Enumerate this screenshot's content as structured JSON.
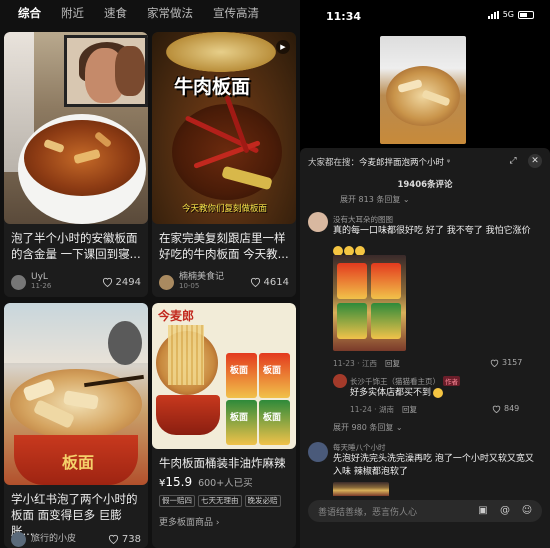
{
  "tabs": [
    "综合",
    "附近",
    "速食",
    "家常做法",
    "宣传高清"
  ],
  "feed": {
    "cards": [
      {
        "title": "泡了半个小时的安徽板面的含金量 一下课回到寝...",
        "author": "UyL",
        "date": "11-26",
        "likes": "2494"
      },
      {
        "overlay_title": "牛肉板面",
        "overlay_caption": "今天教你们复刻做板面",
        "title": "在家完美复刻跟店里一样好吃的牛肉板面 今天教...",
        "author": "楠楠美食记",
        "date": "10-05",
        "likes": "4614"
      },
      {
        "bowl_label": "板面",
        "title": "学小红书泡了两个小时的板面 面变得巨多 巨膨胀...",
        "author": "旅行的小皮",
        "date": "",
        "likes": "738"
      },
      {
        "brand": "今麦郎",
        "package_labels": [
          "板面",
          "板面",
          "板面",
          "板面"
        ],
        "title": "牛肉板面桶装非油炸麻辣",
        "price": "15.9",
        "price_symbol": "¥",
        "sold": "600+人已买",
        "tags": [
          "假一赔四",
          "七天无理由",
          "晚发必赔"
        ],
        "more_link": "更多板面商品 ›"
      }
    ]
  },
  "phone": {
    "status": {
      "time": "11:34",
      "network": "5G"
    },
    "comments_panel": {
      "search_hint_prefix": "大家都在搜：",
      "search_hint_query": "今麦郎拌面泡两个小时",
      "count": "19406条评论",
      "expand_1": "展开 813 条回复 ⌄",
      "expand_2": "展开 980 条回复 ⌄",
      "comments": [
        {
          "user": "没有大耳朵的图图",
          "text": "真的每一口味都很好吃 好了 我不夸了 我怕它涨价",
          "date": "11-23 · 江西",
          "reply": "回复",
          "likes": "3157"
        },
        {
          "user": "长沙千饰王（猫猫看主页）",
          "badge": "作者",
          "text": "好多实体店都买不到",
          "date": "11-24 · 湖南",
          "reply": "回复",
          "likes": "849"
        },
        {
          "user": "每天睡八个小时",
          "text": "先泡好洗完头洗完澡再吃 泡了一个小时又软又宽又入味 辣椒都泡软了",
          "date": "",
          "reply": "",
          "likes": ""
        }
      ],
      "input_placeholder": "善语结善缘，恶言伤人心"
    }
  },
  "colors": {
    "background": "#111111",
    "card": "#1c1c1c",
    "accent_overlay": "#f3e24a",
    "author_badge": "#6b1e2a"
  },
  "icons": [
    "heart-icon",
    "play-icon",
    "sparkle-icon",
    "expand-icon",
    "close-icon",
    "image-icon",
    "at-icon",
    "emoji-icon",
    "signal-icon",
    "battery-icon"
  ]
}
